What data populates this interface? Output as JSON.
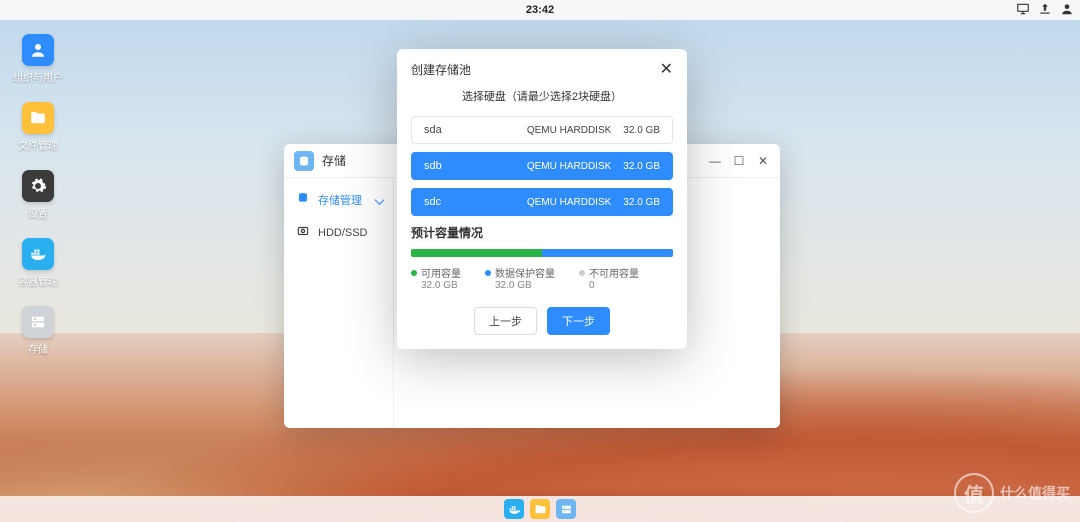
{
  "topbar": {
    "time": "23:42"
  },
  "desk": [
    {
      "icon": "users",
      "label": "组织与用户",
      "tile": "blue"
    },
    {
      "icon": "folder",
      "label": "文件管理",
      "tile": "yellow"
    },
    {
      "icon": "gear",
      "label": "设置",
      "tile": "dark"
    },
    {
      "icon": "container",
      "label": "容器管理",
      "tile": "cyan"
    },
    {
      "icon": "disk",
      "label": "存储",
      "tile": "grey"
    }
  ],
  "storage_window": {
    "title": "存储",
    "sidebar": [
      {
        "label": "存储管理",
        "active": true,
        "icon": "stack"
      },
      {
        "label": "HDD/SSD",
        "active": false,
        "icon": "hdd"
      }
    ]
  },
  "dialog": {
    "title": "创建存储池",
    "subtitle": "选择硬盘（请最少选择2块硬盘）",
    "disks": [
      {
        "name": "sda",
        "model": "QEMU HARDDISK",
        "size": "32.0 GB",
        "selected": false
      },
      {
        "name": "sdb",
        "model": "QEMU HARDDISK",
        "size": "32.0 GB",
        "selected": true
      },
      {
        "name": "sdc",
        "model": "QEMU HARDDISK",
        "size": "32.0 GB",
        "selected": true
      }
    ],
    "capacity_section_title": "预计容量情况",
    "capacity_bar": {
      "usable_pct": 50,
      "protection_pct": 50,
      "unusable_pct": 0
    },
    "legend": [
      {
        "label": "可用容量",
        "value": "32.0 GB"
      },
      {
        "label": "数据保护容量",
        "value": "32.0 GB"
      },
      {
        "label": "不可用容量",
        "value": "0"
      }
    ],
    "buttons": {
      "prev": "上一步",
      "next": "下一步"
    }
  },
  "dock": [
    {
      "icon": "container",
      "bg": "#29aef0"
    },
    {
      "icon": "folder",
      "bg": "#ffc13a"
    },
    {
      "icon": "disk",
      "bg": "#6db6f2"
    }
  ],
  "watermark": {
    "glyph": "值",
    "text": "什么值得买"
  }
}
